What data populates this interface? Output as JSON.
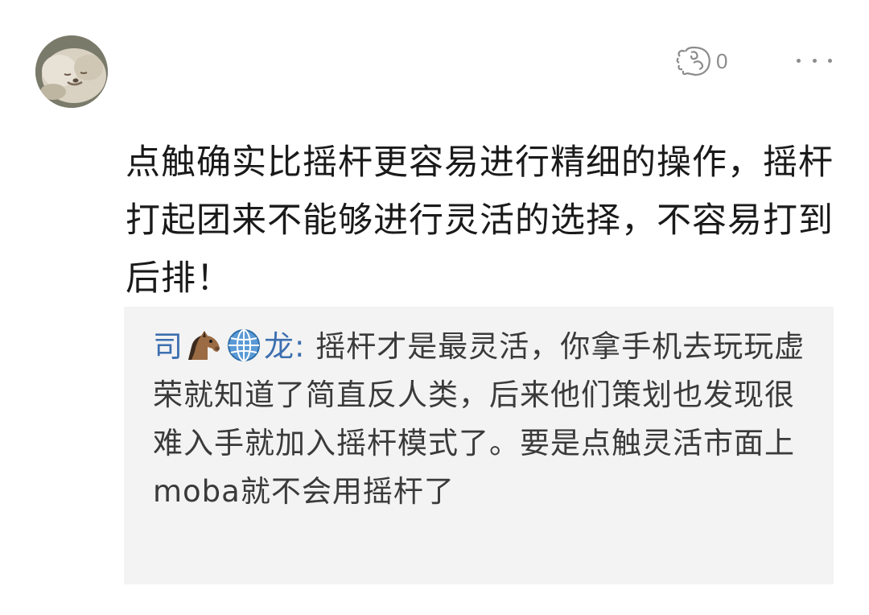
{
  "comment": {
    "like_count": "0",
    "text": "点触确实比摇杆更容易进行精细的操作，摇杆打起团来不能够进行灵活的选择，不容易打到后排！"
  },
  "reply": {
    "author_prefix": "司",
    "author_suffix": "龙",
    "separator": ": ",
    "text": "摇杆才是最灵活，你拿手机去玩玩虚荣就知道了简直反人类，后来他们策划也发现很难入手就加入摇杆模式了。要是点触灵活市面上moba就不会用摇杆了"
  },
  "icons": {
    "avatar": "avatar-dog-photo",
    "like": "thumbs-up-icon",
    "more": "more-dots-icon",
    "emoji_1": "horse-emoji",
    "emoji_2": "globe-emoji"
  },
  "colors": {
    "author_link": "#3d6fb0",
    "reply_background": "#f3f3f3",
    "muted_icon": "#8c8c8c"
  }
}
